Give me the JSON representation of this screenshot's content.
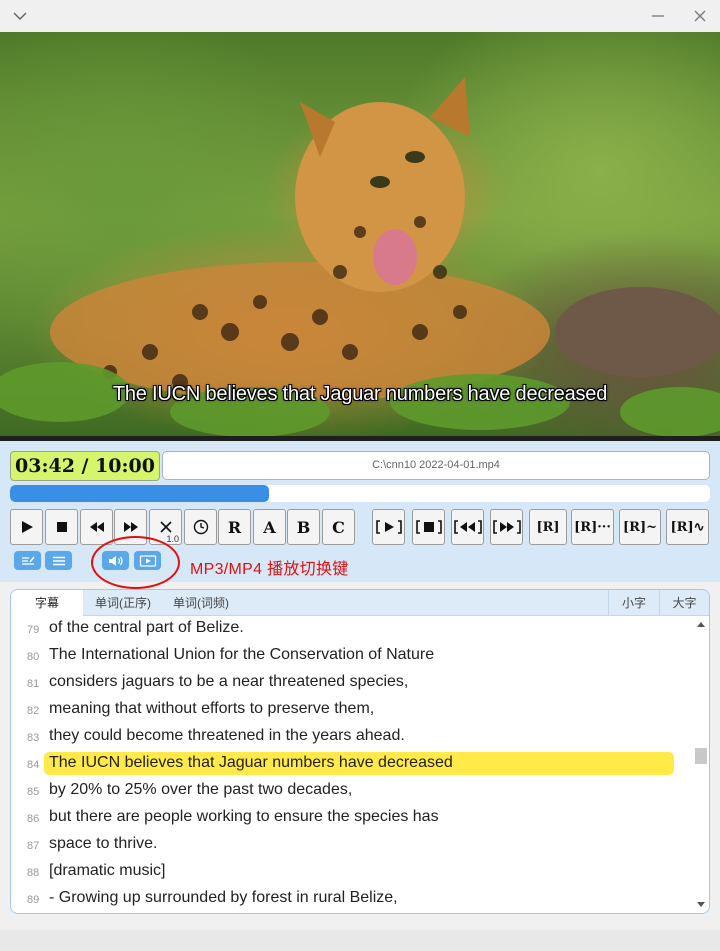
{
  "window": {
    "collapse_icon": "chevron-down-icon",
    "minimize_icon": "minimize-icon",
    "close_icon": "close-icon"
  },
  "video": {
    "subtitle": "The IUCN believes that Jaguar numbers have decreased"
  },
  "player": {
    "time": "03:42 / 10:00",
    "file": "C:\\cnn10 2022-04-01.mp4",
    "progress": 0.37,
    "speed": "1.0",
    "buttons": {
      "play": "▶",
      "stop": "■",
      "rewind": "◀◀",
      "forward": "▶▶",
      "clear": "✕",
      "timer": "◷",
      "r": "R",
      "a": "A",
      "b": "B",
      "c": "C",
      "r_play": "[▶]",
      "r_stop": "[■]",
      "r_rewind": "[◀◀]",
      "r_forward": "[▶▶]",
      "r_bracket": "[R]",
      "r_dots": "[R]···",
      "r_tilde": "[R]~",
      "r_wave": "[R]∿"
    }
  },
  "annotation": {
    "text": "MP3/MP4 播放切换键"
  },
  "tabs": {
    "subtitles": "字幕",
    "words_order": "单词(正序)",
    "words_freq": "单词(词频)",
    "small_font": "小字",
    "large_font": "大字"
  },
  "transcript": [
    {
      "n": "79",
      "text": "of the central part of Belize."
    },
    {
      "n": "80",
      "text": "The International Union for the Conservation of Nature"
    },
    {
      "n": "81",
      "text": "considers jaguars to be a near threatened species,"
    },
    {
      "n": "82",
      "text": "meaning that without efforts to preserve them,"
    },
    {
      "n": "83",
      "text": "they could become threatened in the years ahead."
    },
    {
      "n": "84",
      "text": "The IUCN believes that Jaguar numbers have decreased"
    },
    {
      "n": "85",
      "text": "by 20% to 25% over the past two decades,"
    },
    {
      "n": "86",
      "text": "but there are people working to ensure the species has"
    },
    {
      "n": "87",
      "text": "space to thrive."
    },
    {
      "n": "88",
      "text": "[dramatic music]"
    },
    {
      "n": "89",
      "text": "- Growing up surrounded by forest in rural Belize,"
    }
  ],
  "highlight_index": 5,
  "colors": {
    "time_bg": "#d4f56c",
    "progress": "#3a8ee6",
    "highlight": "#ffea4a",
    "annotation": "#e01010"
  }
}
